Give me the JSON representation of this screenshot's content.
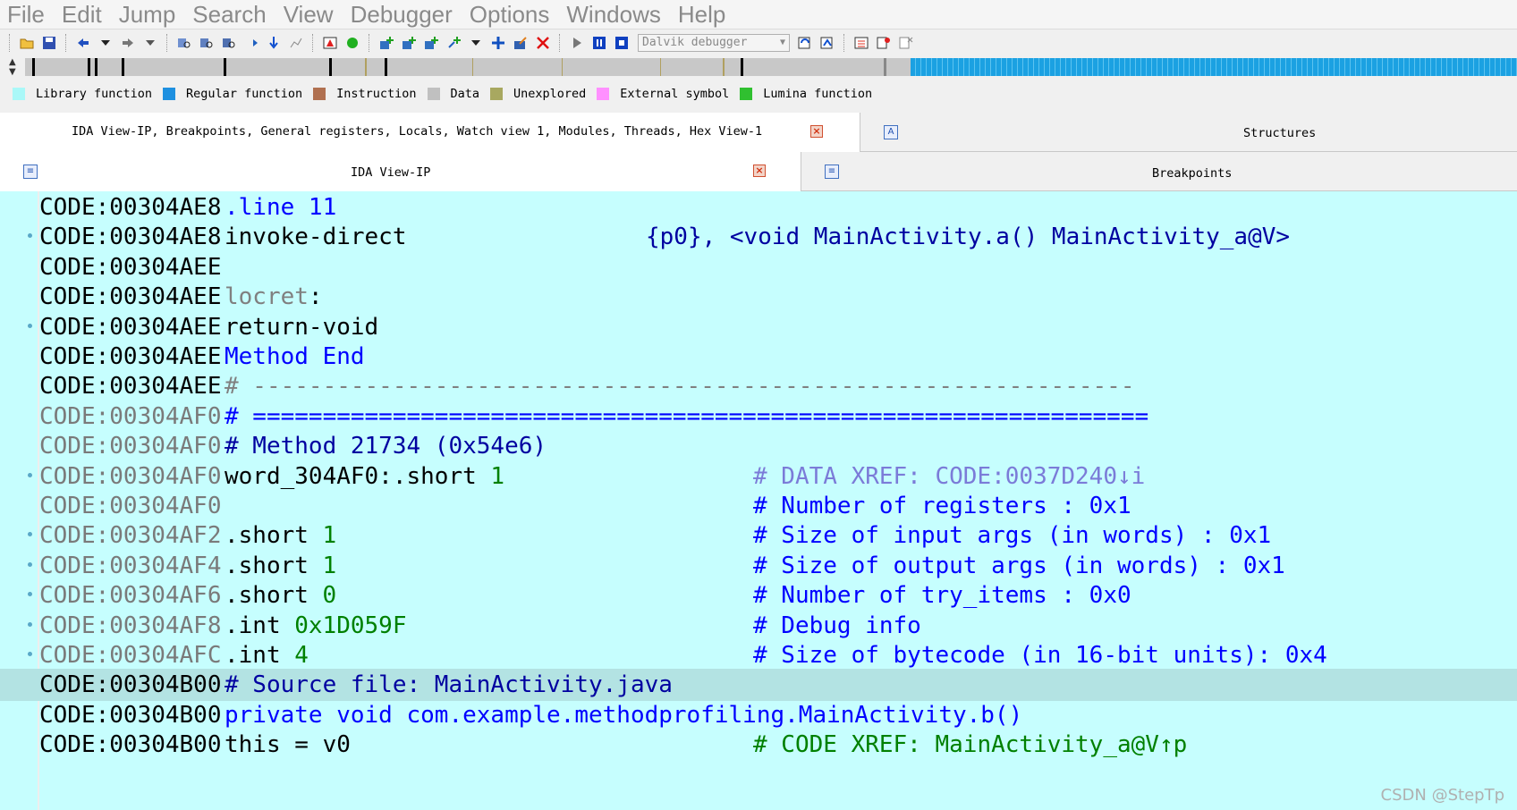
{
  "menu": [
    "File",
    "Edit",
    "Jump",
    "Search",
    "View",
    "Debugger",
    "Options",
    "Windows",
    "Help"
  ],
  "toolbar": {
    "debugger_select": "Dalvik debugger"
  },
  "legend": [
    {
      "label": "Library function",
      "color": "#aaf8f8"
    },
    {
      "label": "Regular function",
      "color": "#1e90e0"
    },
    {
      "label": "Instruction",
      "color": "#b07050"
    },
    {
      "label": "Data",
      "color": "#c0c0c0"
    },
    {
      "label": "Unexplored",
      "color": "#a8a860"
    },
    {
      "label": "External symbol",
      "color": "#ff90ff"
    },
    {
      "label": "Lumina function",
      "color": "#30c030"
    }
  ],
  "tabs": {
    "main_title": "IDA View-IP, Breakpoints, General registers, Locals, Watch view 1, Modules, Threads, Hex View-1",
    "structures": "Structures",
    "ida_view": "IDA View-IP",
    "breakpoints": "Breakpoints"
  },
  "code": [
    {
      "addr": "CODE:00304AE8",
      "gray": false,
      "dot": false,
      "hl": false,
      "instr": ".line 11",
      "ic": "blue",
      "operand": "",
      "comment": ""
    },
    {
      "addr": "CODE:00304AE8",
      "gray": false,
      "dot": true,
      "hl": false,
      "instr": "invoke-direct",
      "ic": "black",
      "operand_a": "{p0}, ",
      "operand_b": "<void MainActivity.a() MainActivity_a@V>",
      "comment": ""
    },
    {
      "addr": "CODE:00304AEE",
      "gray": false,
      "dot": false,
      "hl": false,
      "instr": "",
      "ic": "black",
      "operand": "",
      "comment": ""
    },
    {
      "addr": "CODE:00304AEE",
      "gray": false,
      "dot": false,
      "hl": false,
      "instr": "locret",
      "ic": "gray",
      "suffix": ":",
      "comment": ""
    },
    {
      "addr": "CODE:00304AEE",
      "gray": false,
      "dot": true,
      "hl": false,
      "instr": "return-void",
      "ic": "black",
      "comment": ""
    },
    {
      "addr": "CODE:00304AEE",
      "gray": false,
      "dot": false,
      "hl": false,
      "instr": "Method End",
      "ic": "blue",
      "comment": ""
    },
    {
      "addr": "CODE:00304AEE",
      "gray": false,
      "dot": false,
      "hl": false,
      "instr": "# ---------------------------------------------------------------",
      "ic": "gray",
      "comment": ""
    },
    {
      "addr": "CODE:00304AF0",
      "gray": true,
      "dot": false,
      "hl": false,
      "instr": "# ================================================================",
      "ic": "blue",
      "comment": ""
    },
    {
      "addr": "CODE:00304AF0",
      "gray": true,
      "dot": false,
      "hl": false,
      "instr": "# Method 21734 (0x54e6)",
      "ic": "navy",
      "comment": ""
    },
    {
      "addr": "CODE:00304AF0",
      "gray": true,
      "dot": true,
      "hl": false,
      "instr": "word_304AF0:.short",
      "ic": "black",
      "val": "1",
      "comment": "# DATA XREF: CODE:0037D240↓i",
      "cc": "xref"
    },
    {
      "addr": "CODE:00304AF0",
      "gray": true,
      "dot": false,
      "hl": false,
      "instr": "",
      "ic": "black",
      "comment": "# Number of registers : 0x1",
      "cc": "comment"
    },
    {
      "addr": "CODE:00304AF2",
      "gray": true,
      "dot": true,
      "hl": false,
      "instr": ".short",
      "ic": "black",
      "val": "1",
      "comment": "# Size of input args (in words) : 0x1",
      "cc": "comment"
    },
    {
      "addr": "CODE:00304AF4",
      "gray": true,
      "dot": true,
      "hl": false,
      "instr": ".short",
      "ic": "black",
      "val": "1",
      "comment": "# Size of output args (in words) : 0x1",
      "cc": "comment"
    },
    {
      "addr": "CODE:00304AF6",
      "gray": true,
      "dot": true,
      "hl": false,
      "instr": ".short",
      "ic": "black",
      "val": "0",
      "comment": "# Number of try_items : 0x0",
      "cc": "comment"
    },
    {
      "addr": "CODE:00304AF8",
      "gray": true,
      "dot": true,
      "hl": false,
      "instr": ".int",
      "ic": "black",
      "val": "0x1D059F",
      "comment": "# Debug info",
      "cc": "comment"
    },
    {
      "addr": "CODE:00304AFC",
      "gray": true,
      "dot": true,
      "hl": false,
      "instr": ".int",
      "ic": "black",
      "val": "4",
      "comment": "# Size of bytecode (in 16-bit units): 0x4",
      "cc": "comment"
    },
    {
      "addr": "CODE:00304B00",
      "gray": false,
      "dot": false,
      "hl": true,
      "instr": "# Source file: MainActivity.java",
      "ic": "navy",
      "comment": ""
    },
    {
      "addr": "CODE:00304B00",
      "gray": false,
      "dot": false,
      "hl": false,
      "instr": "private void com.example.methodprofiling.MainActivity.b()",
      "ic": "blue",
      "comment": ""
    },
    {
      "addr": "CODE:00304B00",
      "gray": false,
      "dot": false,
      "hl": false,
      "instr": "this = v0",
      "ic": "black",
      "comment": "# CODE XREF: MainActivity_a@V↑p",
      "cc": "green"
    }
  ],
  "watermark": "CSDN @StepTp"
}
